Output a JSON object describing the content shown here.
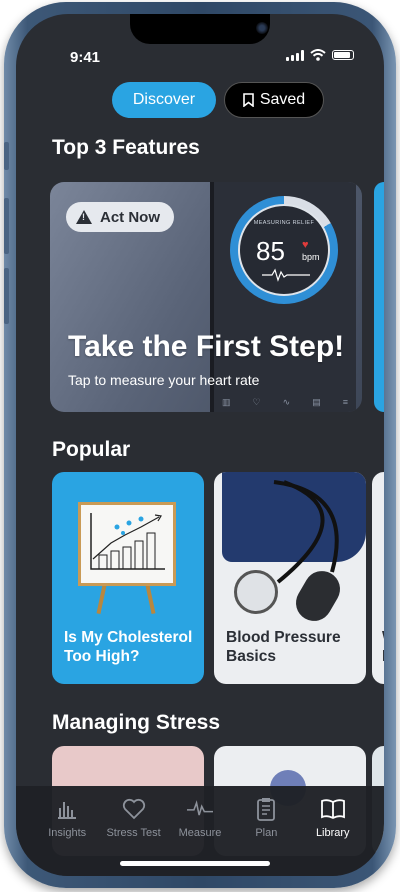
{
  "status": {
    "time": "9:41"
  },
  "segment": {
    "discover": "Discover",
    "saved": "Saved"
  },
  "sections": {
    "top_features": "Top 3 Features",
    "popular": "Popular",
    "managing_stress": "Managing Stress"
  },
  "feature": {
    "badge": "Act Now",
    "title": "Take the First Step!",
    "subtitle": "Tap to measure your heart rate",
    "gauge_label": "MEASURING RELIEF",
    "gauge_bpm": "85",
    "gauge_unit": "bpm"
  },
  "popular": [
    {
      "title": "Is My Cholesterol Too High?"
    },
    {
      "title": "Blood Pressure Basics"
    },
    {
      "title": "W H"
    }
  ],
  "tabs": [
    {
      "label": "Insights",
      "icon": "bar-chart-icon"
    },
    {
      "label": "Stress Test",
      "icon": "heart-icon"
    },
    {
      "label": "Measure",
      "icon": "pulse-icon"
    },
    {
      "label": "Plan",
      "icon": "clipboard-icon"
    },
    {
      "label": "Library",
      "icon": "book-icon"
    }
  ],
  "colors": {
    "accent": "#2aa4e2",
    "background": "#2a2d33",
    "frame": "#2f4866"
  }
}
